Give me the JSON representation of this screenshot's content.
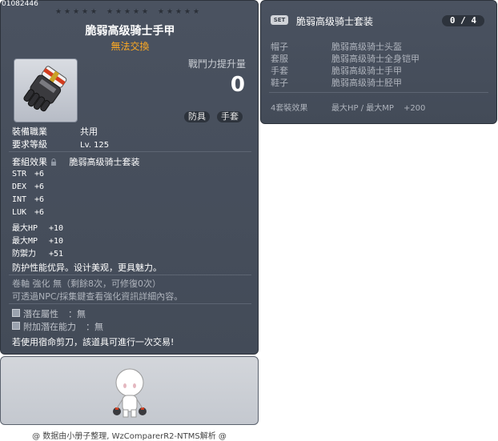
{
  "item_id": "01082446",
  "stars_groups": 3,
  "item": {
    "name": "脆弱高级骑士手甲",
    "trade_status": "無法交換",
    "combat_power_label": "戰鬥力提升量",
    "combat_power_value": "0",
    "tags": [
      "防具",
      "手套"
    ],
    "job_label": "裝備職業",
    "job_value": "共用",
    "level_label": "要求等級",
    "level_value": "Lv. 125",
    "set_label": "套組效果",
    "set_value": "脆弱高级骑士套装",
    "stats": [
      {
        "k": "STR",
        "v": "+6"
      },
      {
        "k": "DEX",
        "v": "+6"
      },
      {
        "k": "INT",
        "v": "+6"
      },
      {
        "k": "LUK",
        "v": "+6"
      },
      {
        "k": "最大HP",
        "v": "+10"
      },
      {
        "k": "最大MP",
        "v": "+10"
      },
      {
        "k": "防禦力",
        "v": "+51"
      }
    ],
    "description": "防护性能优异。设计美观，更具魅力。",
    "scroll_line": "卷軸 強化 無（剩餘8次，可修復0次）",
    "npc_line": "可透過NPC/採集鍵查看強化資訊詳細內容。",
    "potential_label": "潛在屬性",
    "potential_value": "：無",
    "add_potential_label": "附加潛在能力",
    "add_potential_value": "：無",
    "scissors_line": "若使用宿命剪刀，該道具可進行一次交易!"
  },
  "set": {
    "badge": "SET",
    "name": "脆弱高级骑士套装",
    "count": "0 / 4",
    "pieces": [
      {
        "k": "帽子",
        "v": "脆弱高级骑士头盔"
      },
      {
        "k": "套服",
        "v": "脆弱高级骑士全身铠甲"
      },
      {
        "k": "手套",
        "v": "脆弱高级骑士手甲"
      },
      {
        "k": "鞋子",
        "v": "脆弱高级骑士胫甲"
      }
    ],
    "effect_label": "4套裝效果",
    "effect_stats": "最大HP / 最大MP",
    "effect_value": "+200"
  },
  "footer": "@ 数据由小册子整理, WzComparerR2-NTMS解析 @",
  "colors": {
    "panel_bg": "#474f5c",
    "trade_orange": "#ffaa22",
    "text_grey": "#aeb3bc"
  }
}
